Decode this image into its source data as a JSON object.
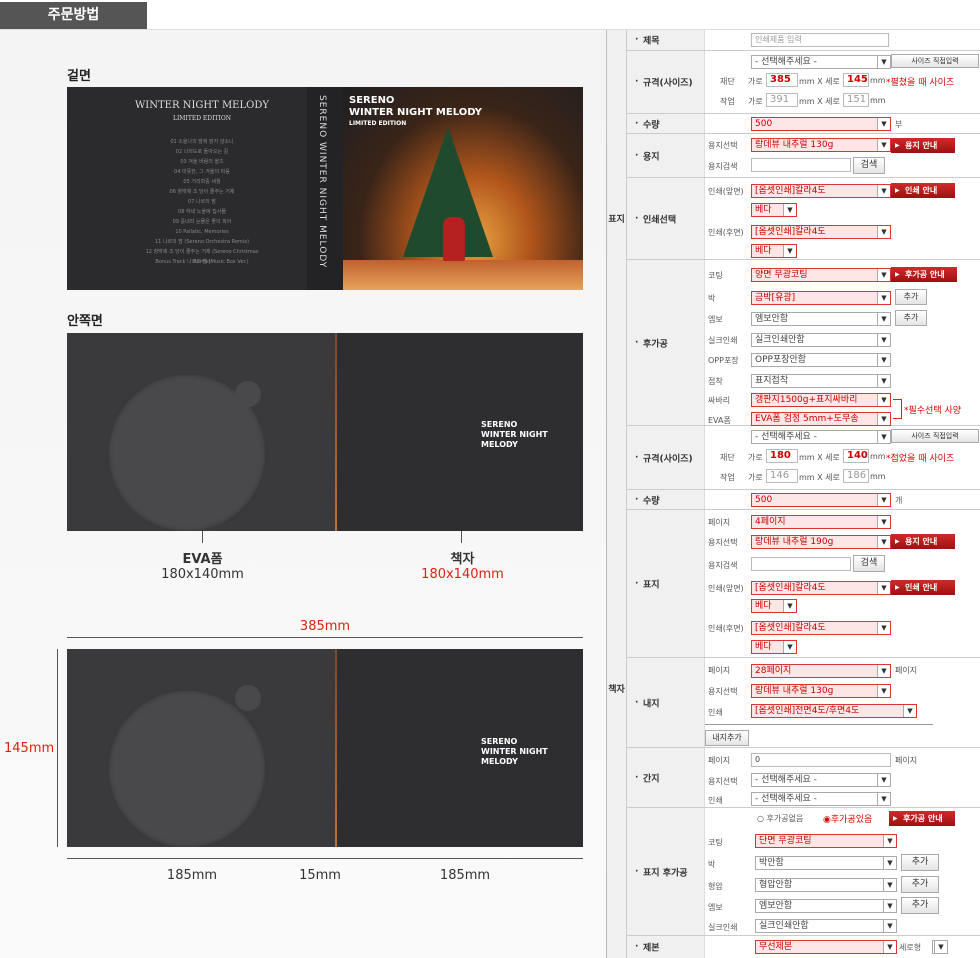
{
  "page": {
    "tab": "주문방법"
  },
  "left": {
    "cover_label": "겉면",
    "inner_label": "안쪽면",
    "cover": {
      "back_title": "WINTER NIGHT MELODY",
      "back_subtitle": "LIMITED EDITION",
      "tracks": [
        "01 소울나의 밤에 밝지 않소니",
        "02 나의도로 돌아오는 길",
        "03 겨울 바람의 왈츠",
        "04 따뜻한, 그 겨울의 마음",
        "05 거리마중 세월",
        "06 창밖에 조 당이 줄주는 거제",
        "07 나르의 밤",
        "08 하네 노울에 집사물",
        "09 흩내려 눈물은 좋이 피어",
        "10 Pallatic, Memories",
        "11 나르의 밤 (Sereno Orchestra Remix)",
        "12 창밖에 조 당이 줄주는 거제 (Sereno Christmas Remix)",
        "Bonus Track 나르의 밤 (Music Box Ver.)"
      ],
      "spine": "SERENO WINTER NIGHT MELODY",
      "front_brand": "SERENO",
      "front_title": "WINTER NIGHT MELODY",
      "front_edition": "LIMITED EDITION"
    },
    "inner_brand": "SERENO",
    "inner_title": "WINTER NIGHT MELODY",
    "eva_label": "EVA폼",
    "eva_size": "180x140mm",
    "booklet_label": "책자",
    "booklet_size": "180x140mm",
    "width_total": "385mm",
    "height": "145mm",
    "seg_left": "185mm",
    "seg_mid": "15mm",
    "seg_right": "185mm"
  },
  "form": {
    "title_label": "제목",
    "title_placeholder": "인쇄제품 입력",
    "group_cover": "표지",
    "group_booklet": "책자",
    "size_label": "규격(사이즈)",
    "size_select": "- 선택해주세요 -",
    "size_btn": "사이즈 직접입력",
    "cut": "재단",
    "work": "작업",
    "w": "가로",
    "mmx": "mm X 세로",
    "mm": "mm",
    "cover_cut_w": "385",
    "cover_cut_h": "145",
    "cover_note": "*펼쳤을 때 사이즈",
    "cover_work_w": "391",
    "cover_work_h": "151",
    "qty_label": "수량",
    "cover_qty": "500",
    "qty_unit": "부",
    "paper_label": "용지",
    "paper_select_label": "용지선택",
    "cover_paper": "랑데뷰 내추럴 130g",
    "paper_btn": "용지 안내",
    "paper_search": "용지검색",
    "search_btn": "검색",
    "print_label": "인쇄선택",
    "print_front": "인쇄(앞면)",
    "print_back": "인쇄(후면)",
    "print_val": "[옵셋인쇄]칼라4도",
    "beta": "베다",
    "print_btn": "인쇄 안내",
    "post_label": "후가공",
    "coating": "코팅",
    "cover_coating": "양면 무광코팅",
    "post_btn": "후가공 안내",
    "foil": "박",
    "cover_foil": "금박[유광]",
    "add": "추가",
    "emboss": "엠보",
    "emboss_val": "엠보안함",
    "silk": "실크인쇄",
    "silk_val": "실크인쇄안함",
    "opp": "OPP포장",
    "opp_val": "OPP포장안함",
    "fold": "접착",
    "fold_val": "표지접착",
    "sabari": "싸바리",
    "sabari_val": "갱판지1500g+표지싸바리",
    "evafoam": "EVA폼",
    "eva_val": "EVA폼 검정 5mm+도무송",
    "req_note": "*필수선택 사양",
    "bk_cut_w": "180",
    "bk_cut_h": "140",
    "bk_note": "*접었을 때 사이즈",
    "bk_work_w": "146",
    "bk_work_h": "186",
    "bk_qty": "500",
    "bk_qty_unit": "개",
    "cover2": "표지",
    "page": "페이지",
    "cover_pages": "4페이지",
    "bk_paper": "랑데뷰 내추럴 190g",
    "inner_label": "내지",
    "inner_pages": "28페이지",
    "page_unit": "페이지",
    "inner_paper": "랑데뷰 내추럴 130g",
    "print": "인쇄",
    "inner_print": "[옵셋인쇄]전면4도/후면4도",
    "inner_add": "내지추가",
    "insert_label": "간지",
    "insert_pages": "0",
    "select_default": "- 선택해주세요 -",
    "post2_label": "표지 후가공",
    "no_post": "후가공없음",
    "yes_post": "후가공있음",
    "bk_coating": "단면 무광코팅",
    "foil_val": "박안함",
    "press": "형압",
    "press_val": "형압안함",
    "bind_label": "제본",
    "bind_val": "무선제본",
    "bind_dir": "세로형"
  }
}
